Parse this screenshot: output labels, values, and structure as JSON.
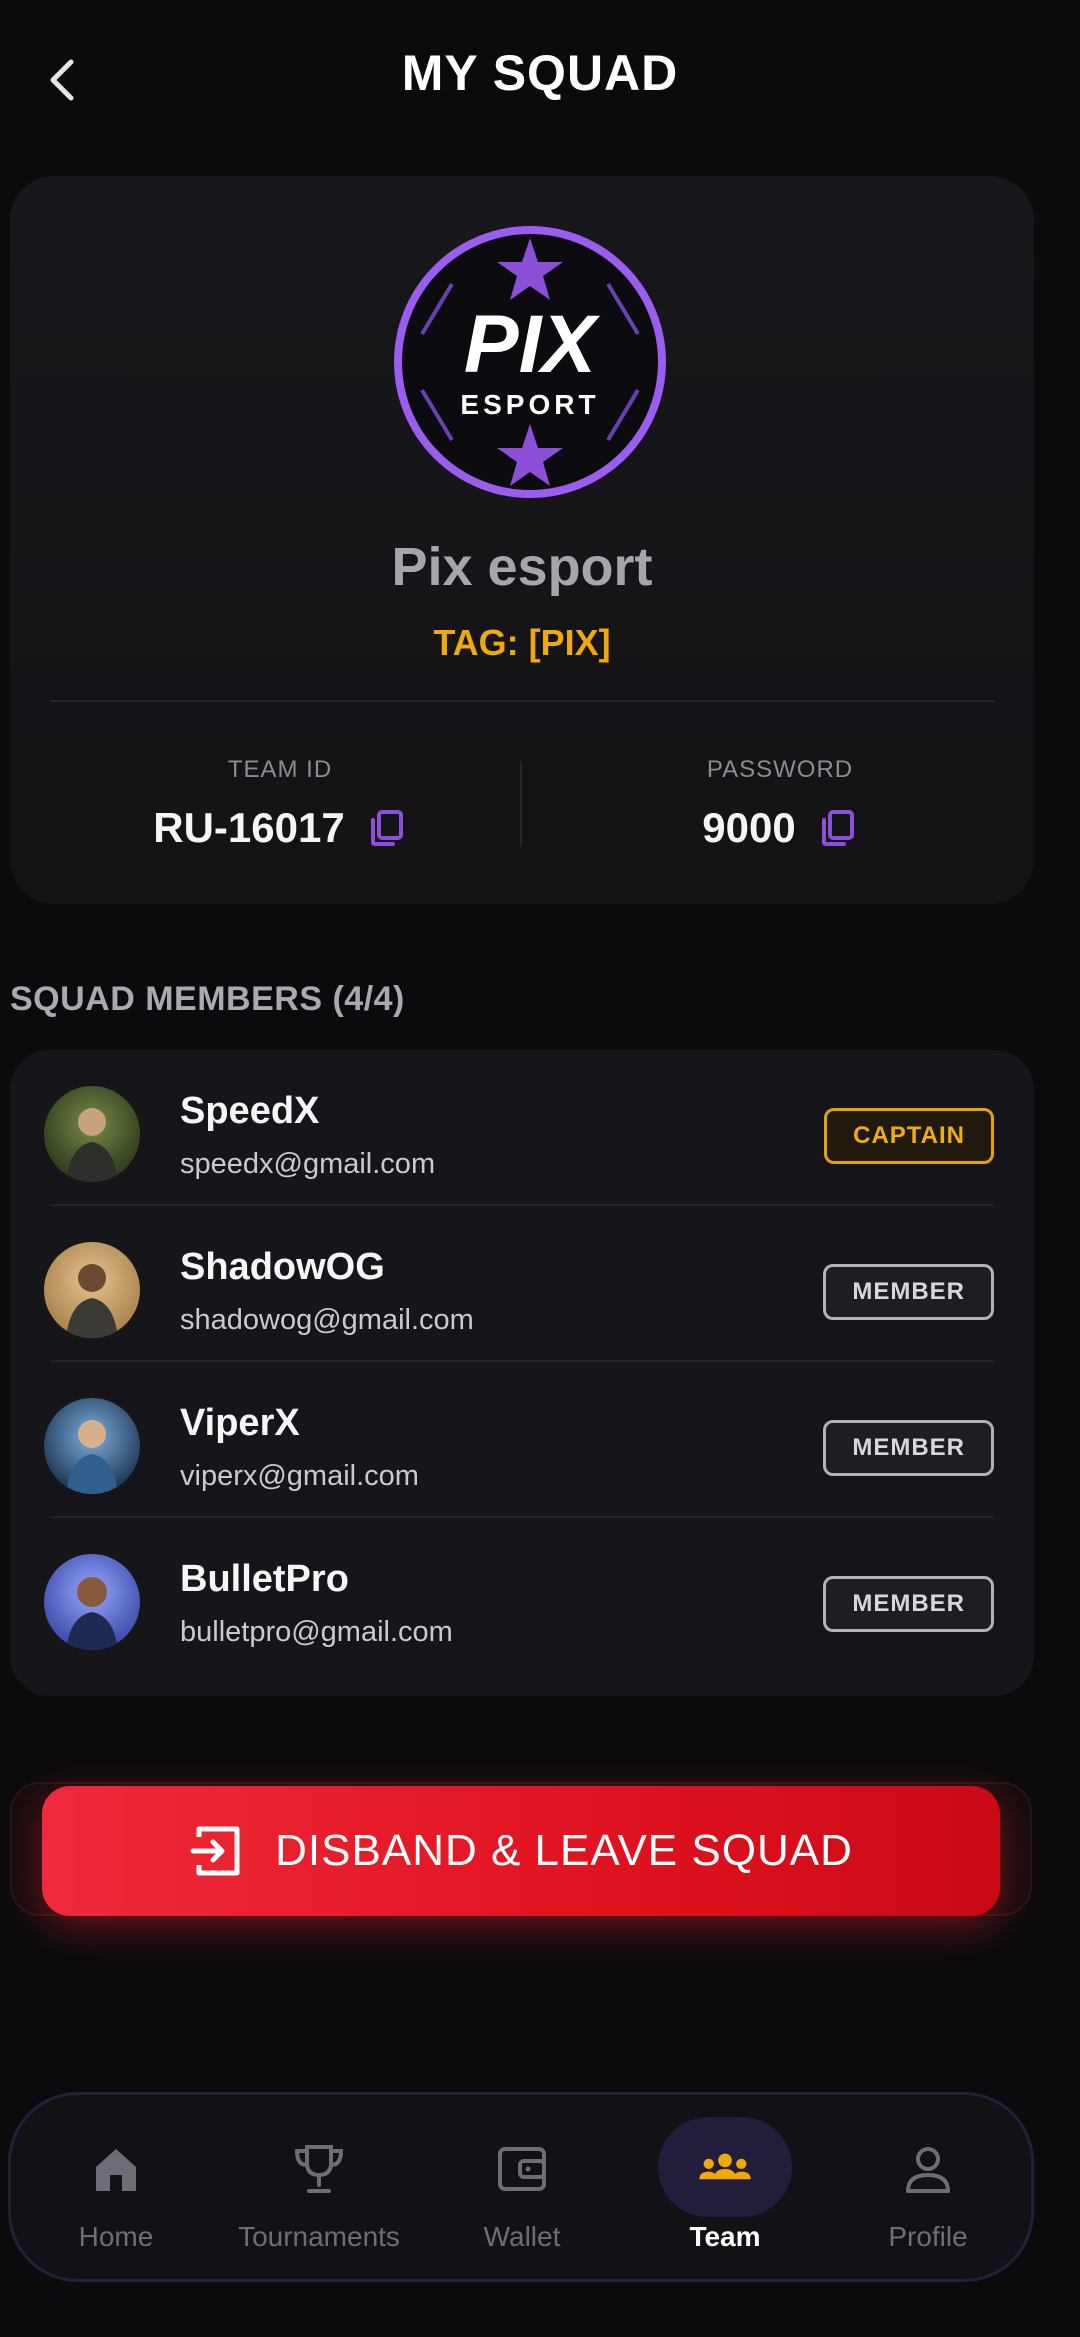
{
  "header": {
    "title": "MY SQUAD"
  },
  "team": {
    "logo_text": "PIX",
    "logo_subtext": "ESPORT",
    "name": "Pix esport",
    "tag": "TAG: [PIX]",
    "team_id_label": "TEAM ID",
    "team_id": "RU-16017",
    "password_label": "PASSWORD",
    "password": "9000"
  },
  "members_section": {
    "title": "SQUAD MEMBERS (4/4)",
    "members": [
      {
        "name": "SpeedX",
        "email": "speedx@gmail.com",
        "role": "CAPTAIN"
      },
      {
        "name": "ShadowOG",
        "email": "shadowog@gmail.com",
        "role": "MEMBER"
      },
      {
        "name": "ViperX",
        "email": "viperx@gmail.com",
        "role": "MEMBER"
      },
      {
        "name": "BulletPro",
        "email": "bulletpro@gmail.com",
        "role": "MEMBER"
      }
    ]
  },
  "actions": {
    "disband_label": "DISBAND & LEAVE SQUAD"
  },
  "nav": {
    "items": [
      {
        "label": "Home",
        "icon": "home-icon"
      },
      {
        "label": "Tournaments",
        "icon": "trophy-icon"
      },
      {
        "label": "Wallet",
        "icon": "wallet-icon"
      },
      {
        "label": "Team",
        "icon": "team-icon",
        "active": true
      },
      {
        "label": "Profile",
        "icon": "profile-icon"
      }
    ]
  },
  "colors": {
    "accent_purple": "#8b4fd8",
    "gold": "#f0a90a",
    "danger": "#e0121f",
    "background": "#0b0b0d"
  }
}
